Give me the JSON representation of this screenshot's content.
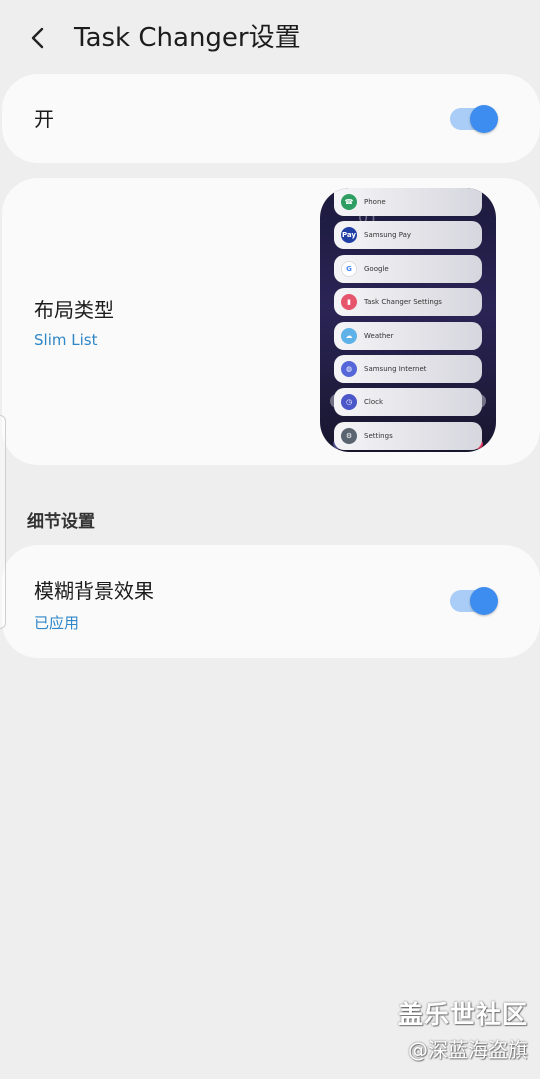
{
  "header": {
    "title": "Task Changer设置"
  },
  "main_toggle": {
    "label": "开",
    "on": true
  },
  "layout": {
    "title": "布局类型",
    "value": "Slim List"
  },
  "preview": {
    "ghost_clock": "01",
    "tasks": [
      {
        "label": "Phone",
        "icon": "phone-icon",
        "color": "#2e9e62",
        "glyph": "☎"
      },
      {
        "label": "Samsung Pay",
        "icon": "samsung-pay-icon",
        "color": "#1f3fa5",
        "glyph": "Pay"
      },
      {
        "label": "Google",
        "icon": "google-icon",
        "color": "#ffffff",
        "glyph": "G"
      },
      {
        "label": "Task Changer Settings",
        "icon": "task-changer-icon",
        "color": "#e5556b",
        "glyph": "▮"
      },
      {
        "label": "Weather",
        "icon": "weather-icon",
        "color": "#5fb2e8",
        "glyph": "☁"
      },
      {
        "label": "Samsung Internet",
        "icon": "samsung-internet-icon",
        "color": "#5566d8",
        "glyph": "◍"
      },
      {
        "label": "Clock",
        "icon": "clock-icon",
        "color": "#4b56c9",
        "glyph": "◷"
      },
      {
        "label": "Settings",
        "icon": "settings-icon",
        "color": "#5a6470",
        "glyph": "⚙"
      }
    ]
  },
  "details": {
    "section_title": "细节设置",
    "blur": {
      "title": "模糊背景效果",
      "status": "已应用",
      "on": true
    }
  },
  "watermark": {
    "line1": "盖乐世社区",
    "line2": "@深蓝海盗旗"
  },
  "colors": {
    "accent": "#3d8df0",
    "link": "#2f86c8",
    "background": "#eeeeee"
  }
}
